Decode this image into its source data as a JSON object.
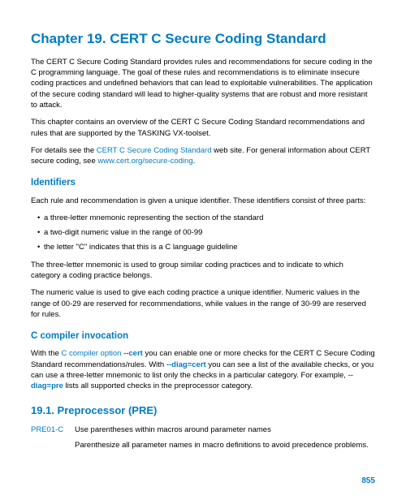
{
  "chapter_title": "Chapter 19. CERT C Secure Coding Standard",
  "intro_p1": "The CERT C Secure Coding Standard provides rules and recommendations for secure coding in the C programming language. The goal of these rules and recommendations is to eliminate insecure coding practices and undefined behaviors that can lead to exploitable vulnerabilities. The application of the secure coding standard will lead to higher-quality systems that are robust and more resistant to attack.",
  "intro_p2": "This chapter contains an overview of the CERT C Secure Coding Standard recommendations and rules that are supported by the TASKING VX-toolset.",
  "intro_p3_a": "For details see the ",
  "intro_p3_link1": "CERT C Secure Coding Standard",
  "intro_p3_b": " web site. For general information about CERT secure coding, see ",
  "intro_p3_link2": "www.cert.org/secure-coding",
  "intro_p3_c": ".",
  "identifiers_heading": "Identifiers",
  "id_p1": "Each rule and recommendation is given a unique identifier. These identifiers consist of three parts:",
  "id_bullets": [
    "a three-letter mnemonic representing the section of the standard",
    "a two-digit numeric value in the range of 00-99",
    "the letter \"C\" indicates that this is a C language guideline"
  ],
  "id_p2": "The three-letter mnemonic is used to group similar coding practices and to indicate to which category a coding practice belongs.",
  "id_p3": "The numeric value is used to give each coding practice a unique identifier. Numeric values in the range of 00-29 are reserved for recommendations, while values in the range of 30-99 are reserved for rules.",
  "compiler_heading": "C compiler invocation",
  "comp_a": "With the ",
  "comp_link1": "C compiler option ",
  "comp_opt1": "--cert",
  "comp_b": " you can enable one or more checks for the CERT C Secure Coding Standard recommendations/rules. With ",
  "comp_opt2": "--diag=cert",
  "comp_c": " you can see a list of the available checks, or you can use a three-letter mnemonic to list only the checks in a particular category. For example, ",
  "comp_opt3": "--diag=pre",
  "comp_d": " lists all supported checks in the preprocessor category.",
  "section_heading": "19.1. Preprocessor (PRE)",
  "rule_id": "PRE01-C",
  "rule_text": "Use parentheses within macros around parameter names",
  "rule_desc": "Parenthesize all parameter names in macro definitions to avoid precedence problems.",
  "page_number": "855"
}
